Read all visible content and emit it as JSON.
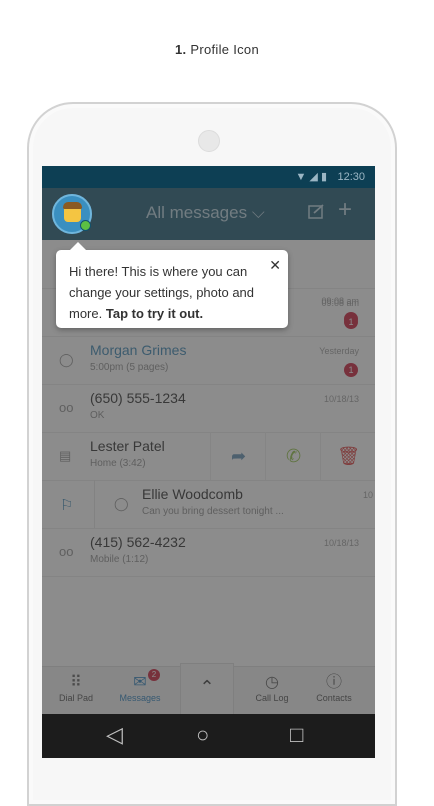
{
  "caption": {
    "number": "1.",
    "text": "Profile Icon"
  },
  "status": {
    "time": "12:30"
  },
  "appbar": {
    "title": "All messages ⌵"
  },
  "tooltip": {
    "text": "Hi there! This is where you can change your settings, photo and more.",
    "bold": "Tap to try it out.",
    "close": "✕"
  },
  "messages": [
    {
      "name": "",
      "sub": "",
      "date": "09:08 am",
      "badge": "1"
    },
    {
      "name": "Morgan Grimes",
      "sub": "5:00pm (5 pages)",
      "date": "Yesterday",
      "badge": "1"
    },
    {
      "name": "(650) 555-1234",
      "sub": "OK",
      "date": "10/18/13",
      "badge": ""
    },
    {
      "name": "Lester Patel",
      "sub": "Home (3:42)",
      "date": "",
      "badge": ""
    },
    {
      "name": "Ellie Woodcomb",
      "sub": "Can you bring dessert tonight ...",
      "date": "10",
      "badge": ""
    },
    {
      "name": "(415) 562-4232",
      "sub": "Mobile (1:12)",
      "date": "10/18/13",
      "badge": ""
    }
  ],
  "tabs": {
    "dialpad": "Dial Pad",
    "messages": "Messages",
    "messages_badge": "2",
    "calllog": "Call Log",
    "contacts": "Contacts"
  }
}
